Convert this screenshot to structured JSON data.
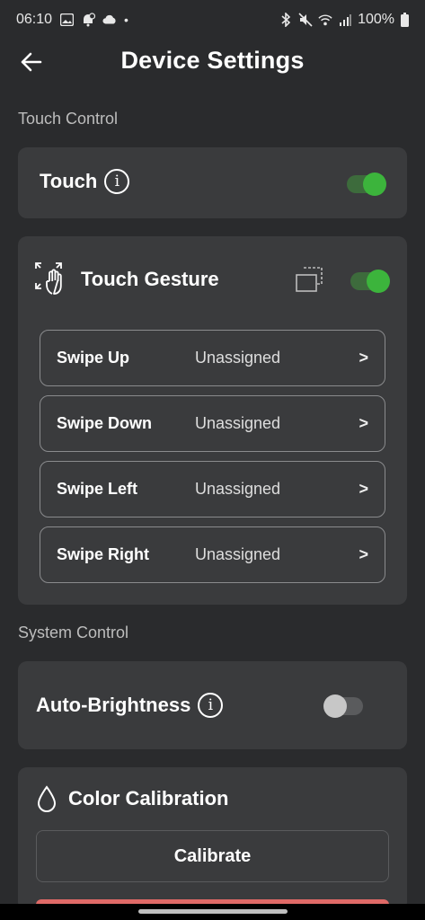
{
  "status_bar": {
    "time": "06:10",
    "dot": "•",
    "battery": "100%",
    "icons_left": [
      "image-icon",
      "notification-settings-icon",
      "cloud-icon"
    ],
    "icons_right": [
      "bluetooth-icon",
      "mute-icon",
      "wifi-icon",
      "signal-icon",
      "battery-icon"
    ]
  },
  "header": {
    "title": "Device Settings",
    "back_icon": "arrow-left-icon"
  },
  "touch_control": {
    "section_label": "Touch Control",
    "touch": {
      "label": "Touch",
      "enabled": true
    },
    "touch_gesture": {
      "label": "Touch Gesture",
      "enabled": true,
      "items": [
        {
          "label": "Swipe Up",
          "value": "Unassigned",
          "chevron": ">"
        },
        {
          "label": "Swipe Down",
          "value": "Unassigned",
          "chevron": ">"
        },
        {
          "label": "Swipe Left",
          "value": "Unassigned",
          "chevron": ">"
        },
        {
          "label": "Swipe Right",
          "value": "Unassigned",
          "chevron": ">"
        }
      ]
    }
  },
  "system_control": {
    "section_label": "System Control",
    "auto_brightness": {
      "label": "Auto-Brightness",
      "enabled": false
    },
    "color_calibration": {
      "label": "Color Calibration",
      "button_label": "Calibrate"
    }
  },
  "colors": {
    "background": "#2a2b2d",
    "card": "#3a3b3d",
    "toggle_on": "#3cb43c",
    "toggle_off_knob": "#c7c7c7",
    "danger": "#e06a67"
  },
  "info_glyph": "i"
}
